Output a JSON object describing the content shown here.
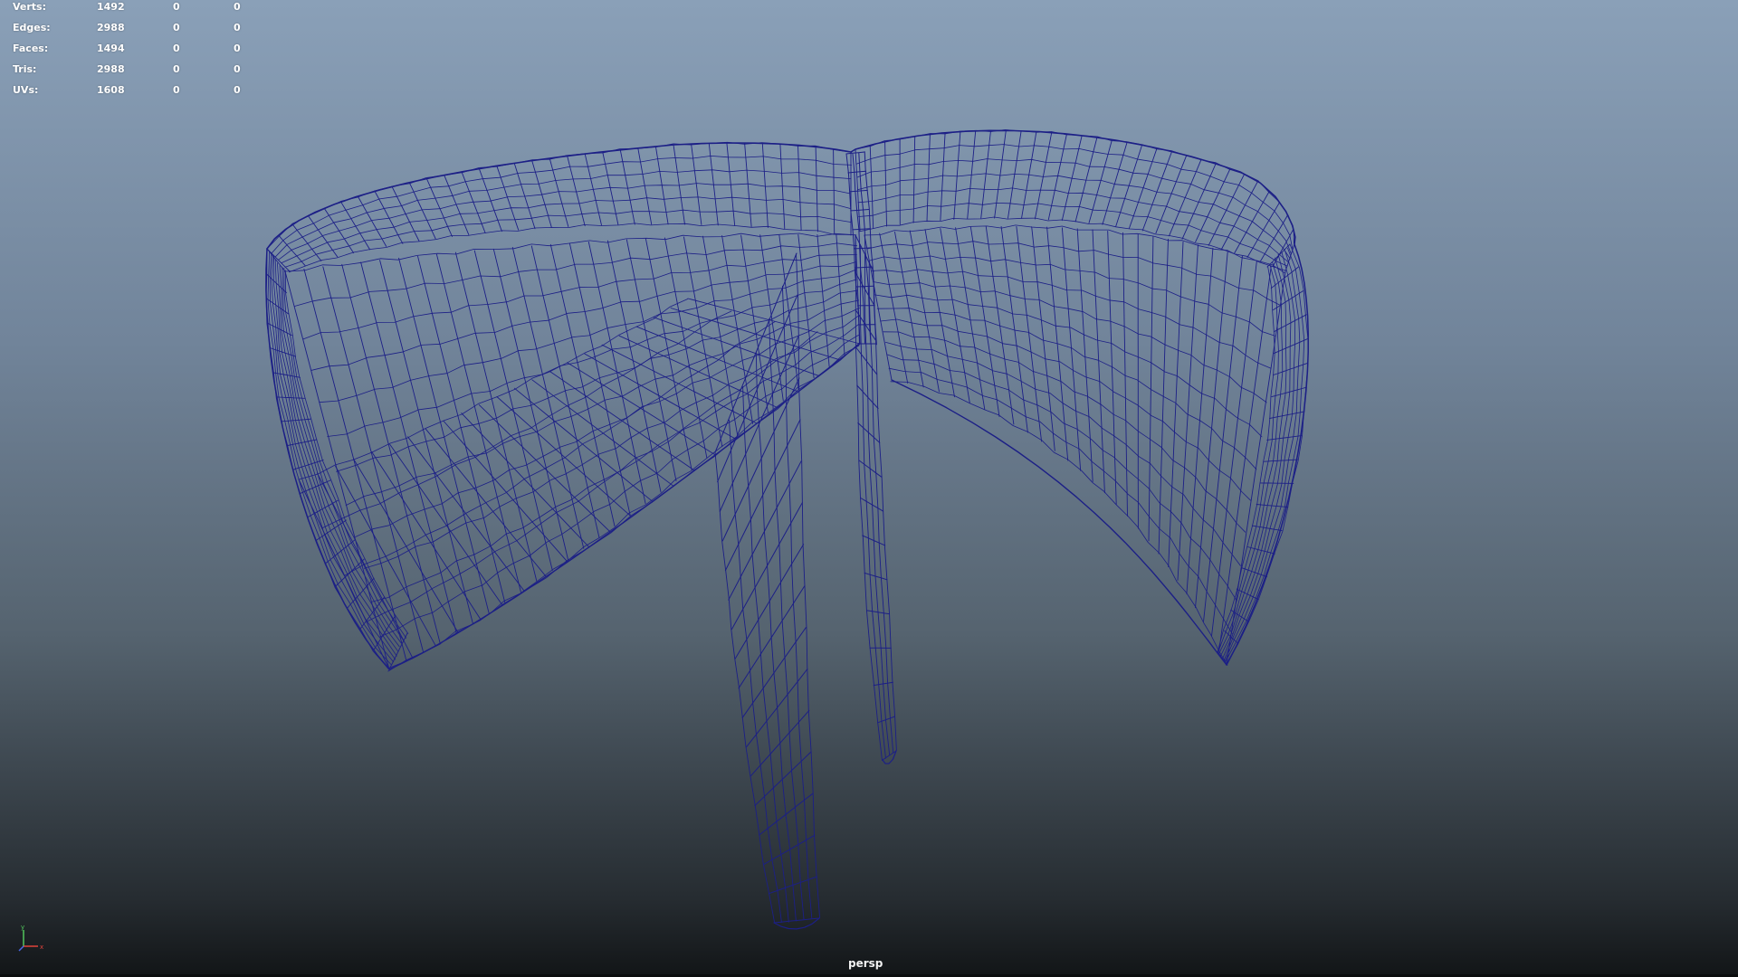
{
  "hud": {
    "rows": [
      {
        "label": "Verts:",
        "total": "1492",
        "selected": "0",
        "uv": "0"
      },
      {
        "label": "Edges:",
        "total": "2988",
        "selected": "0",
        "uv": "0"
      },
      {
        "label": "Faces:",
        "total": "1494",
        "selected": "0",
        "uv": "0"
      },
      {
        "label": "Tris:",
        "total": "2988",
        "selected": "0",
        "uv": "0"
      },
      {
        "label": "UVs:",
        "total": "1608",
        "selected": "0",
        "uv": "0"
      }
    ]
  },
  "viewport": {
    "camera": "persp",
    "wireframe_color": "#1c1f86",
    "axis_colors": {
      "x": "#e0433b",
      "y": "#52c65c",
      "z": "#4a68e8"
    },
    "axis_labels": {
      "x": "x",
      "y": "y"
    }
  }
}
